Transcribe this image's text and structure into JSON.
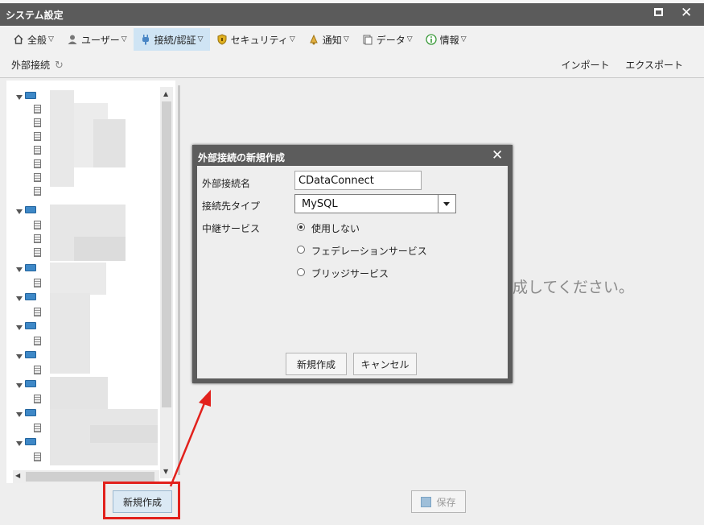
{
  "window": {
    "title": "システム設定"
  },
  "tabs": [
    {
      "label": "全般",
      "icon": "home-icon"
    },
    {
      "label": "ユーザー",
      "icon": "user-icon"
    },
    {
      "label": "接続/認証",
      "icon": "plug-icon",
      "active": true
    },
    {
      "label": "セキュリティ",
      "icon": "shield-icon"
    },
    {
      "label": "通知",
      "icon": "bell-icon"
    },
    {
      "label": "データ",
      "icon": "data-icon"
    },
    {
      "label": "情報",
      "icon": "info-icon"
    }
  ],
  "subheader": {
    "title": "外部接続",
    "refresh_icon": "refresh-icon"
  },
  "toplinks": {
    "import": "インポート",
    "export": "エクスポート"
  },
  "left": {
    "new_button": "新規作成"
  },
  "footer": {
    "save_button": "保存"
  },
  "main": {
    "hint": "成してください。"
  },
  "dialog": {
    "title": "外部接続の新規作成",
    "name_label": "外部接続名",
    "name_value": "CDataConnect",
    "type_label": "接続先タイプ",
    "type_value": "MySQL",
    "relay_label": "中継サービス",
    "options": [
      {
        "label": "使用しない",
        "checked": true
      },
      {
        "label": "フェデレーションサービス",
        "checked": false
      },
      {
        "label": "ブリッジサービス",
        "checked": false
      }
    ],
    "create_button": "新規作成",
    "cancel_button": "キャンセル"
  },
  "colors": {
    "titlebar": "#5b5b5b",
    "active_tab": "#cfe4f4",
    "highlight": "#e2211c",
    "folder": "#3e88c7"
  }
}
